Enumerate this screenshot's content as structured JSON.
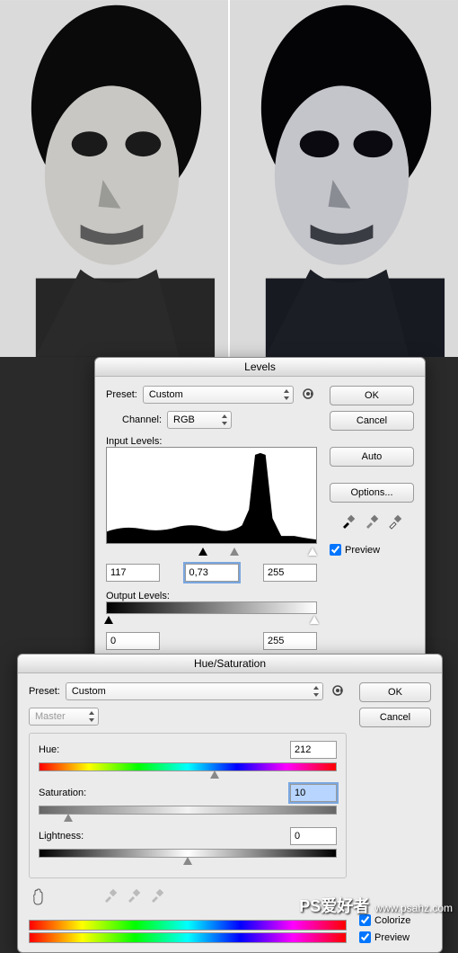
{
  "watermark": {
    "cn": "PS爱好者",
    "en": "www.psahz.com"
  },
  "levels": {
    "title": "Levels",
    "preset_label": "Preset:",
    "preset_value": "Custom",
    "channel_label": "Channel:",
    "channel_value": "RGB",
    "input_label": "Input Levels:",
    "in_black": "117",
    "in_gamma": "0,73",
    "in_white": "255",
    "output_label": "Output Levels:",
    "out_black": "0",
    "out_white": "255",
    "ok": "OK",
    "cancel": "Cancel",
    "auto": "Auto",
    "options": "Options...",
    "preview": "Preview"
  },
  "huesat": {
    "title": "Hue/Saturation",
    "preset_label": "Preset:",
    "preset_value": "Custom",
    "master": "Master",
    "hue_label": "Hue:",
    "hue_value": "212",
    "sat_label": "Saturation:",
    "sat_value": "10",
    "light_label": "Lightness:",
    "light_value": "0",
    "ok": "OK",
    "cancel": "Cancel",
    "colorize": "Colorize",
    "preview": "Preview"
  }
}
